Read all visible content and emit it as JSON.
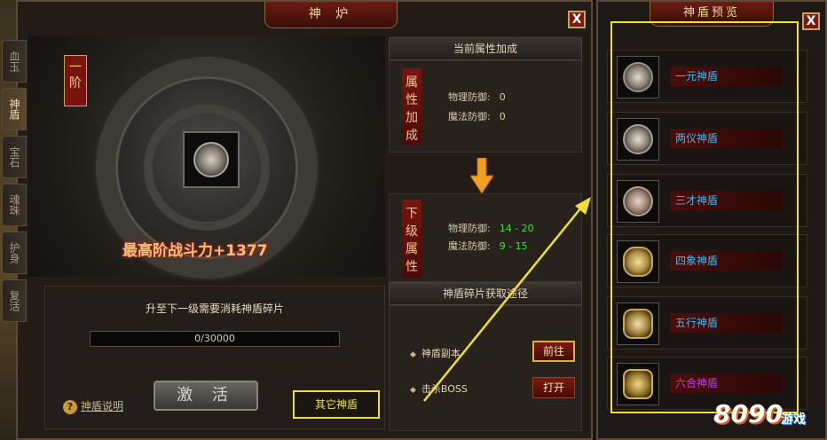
{
  "main_window": {
    "title": "神 炉",
    "close_label": "X"
  },
  "tabs": [
    {
      "label": "血玉",
      "active": false
    },
    {
      "label": "神盾",
      "active": true
    },
    {
      "label": "宝石",
      "active": false
    },
    {
      "label": "魂珠",
      "active": false
    },
    {
      "label": "护身",
      "active": false
    },
    {
      "label": "复活",
      "active": false
    }
  ],
  "shield_art": {
    "rank_label": "一阶",
    "power_text": "最高阶战斗力+1377"
  },
  "upgrade": {
    "title": "升至下一级需要消耗神盾碎片",
    "progress_text": "0/30000",
    "progress_fraction": 0,
    "activate_label": "激 活",
    "help_icon": "?",
    "help_label": "神盾说明",
    "other_shields_label": "其它神盾"
  },
  "current_attrs": {
    "header": "当前属性加成",
    "banner": "属性加成",
    "stats": [
      {
        "label": "物理防御:",
        "value": "0"
      },
      {
        "label": "魔法防御:",
        "value": "0"
      }
    ]
  },
  "next_attrs": {
    "banner": "下级属性",
    "stats": [
      {
        "label": "物理防御:",
        "value": "14 - 20"
      },
      {
        "label": "魔法防御:",
        "value": "9 - 15"
      }
    ]
  },
  "sources": {
    "header": "神盾碎片获取途径",
    "routes": [
      {
        "label": "神盾副本",
        "button": "前往"
      },
      {
        "label": "击杀BOSS",
        "button": "打开"
      }
    ]
  },
  "preview_window": {
    "title": "神盾预览",
    "close_label": "X",
    "items": [
      {
        "name": "一元神盾",
        "color": "#40b8f0"
      },
      {
        "name": "两仪神盾",
        "color": "#40b8f0"
      },
      {
        "name": "三才神盾",
        "color": "#40b8f0"
      },
      {
        "name": "四象神盾",
        "color": "#40b8f0"
      },
      {
        "name": "五行神盾",
        "color": "#40b8f0"
      },
      {
        "name": "六合神盾",
        "color": "#c040f0"
      }
    ]
  },
  "watermark": {
    "main": "8090",
    "sub": "游戏"
  },
  "colors": {
    "highlight": "#f0e030",
    "green_value": "#40e040",
    "power_text": "#f0c080"
  }
}
